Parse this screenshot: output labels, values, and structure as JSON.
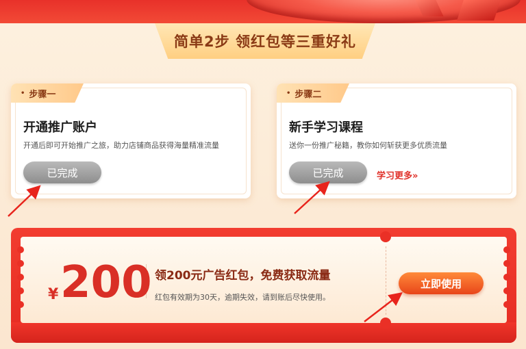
{
  "headline": "简单2步 领红包等三重好礼",
  "steps": [
    {
      "tag": "步骤一",
      "title": "开通推广账户",
      "desc": "开通后即可开始推广之旅，助力店铺商品获得海量精准流量",
      "button": "已完成"
    },
    {
      "tag": "步骤二",
      "title": "新手学习课程",
      "desc": "送你一份推广秘籍，教你如何斩获更多优质流量",
      "button": "已完成",
      "link": "学习更多»"
    }
  ],
  "coupon": {
    "currency": "¥",
    "amount": "200",
    "title": "领200元广告红包，免费获取流量",
    "desc": "红包有效期为30天，逾期失效，请到账后尽快使用。",
    "button": "立即使用"
  },
  "colors": {
    "accent_red": "#e52b22",
    "amount_red": "#d92f26",
    "button_orange": "#ff8a3a",
    "done_gray": "#8e8e8e",
    "background": "#fbe9d3"
  },
  "icons": {
    "step_dot": "bullet-dot-icon",
    "annotation": "red-arrow-annotation"
  }
}
